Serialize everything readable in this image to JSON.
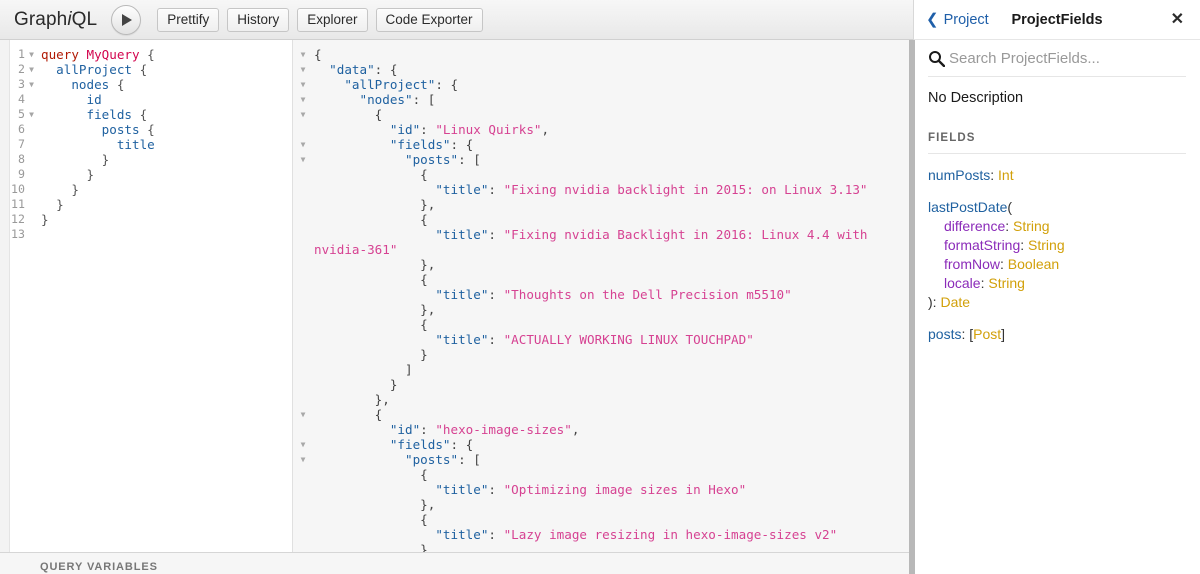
{
  "toolbar": {
    "logo_prefix": "Graph",
    "logo_italic": "i",
    "logo_suffix": "QL",
    "execute_label": "execute-query",
    "buttons": [
      {
        "label": "Prettify",
        "name": "prettify-button"
      },
      {
        "label": "History",
        "name": "history-button"
      },
      {
        "label": "Explorer",
        "name": "explorer-button"
      },
      {
        "label": "Code Exporter",
        "name": "code-exporter-button"
      }
    ]
  },
  "query_editor": {
    "variables_label": "QUERY VARIABLES",
    "lines": [
      {
        "num": "1",
        "fold": true,
        "indent": 0,
        "tokens": [
          {
            "t": "query",
            "c": "kw"
          },
          {
            "t": " ",
            "c": "pun"
          },
          {
            "t": "MyQuery",
            "c": "def"
          },
          {
            "t": " {",
            "c": "pun"
          }
        ]
      },
      {
        "num": "2",
        "fold": true,
        "indent": 1,
        "tokens": [
          {
            "t": "allProject",
            "c": "fld"
          },
          {
            "t": " {",
            "c": "pun"
          }
        ]
      },
      {
        "num": "3",
        "fold": true,
        "indent": 2,
        "tokens": [
          {
            "t": "nodes",
            "c": "fld"
          },
          {
            "t": " {",
            "c": "pun"
          }
        ]
      },
      {
        "num": "4",
        "fold": false,
        "indent": 3,
        "tokens": [
          {
            "t": "id",
            "c": "fld"
          }
        ]
      },
      {
        "num": "5",
        "fold": true,
        "indent": 3,
        "tokens": [
          {
            "t": "fields",
            "c": "fld"
          },
          {
            "t": " {",
            "c": "pun"
          }
        ]
      },
      {
        "num": "6",
        "fold": false,
        "indent": 4,
        "tokens": [
          {
            "t": "posts",
            "c": "fld"
          },
          {
            "t": " {",
            "c": "pun"
          }
        ]
      },
      {
        "num": "7",
        "fold": false,
        "indent": 5,
        "tokens": [
          {
            "t": "title",
            "c": "fld"
          }
        ]
      },
      {
        "num": "8",
        "fold": false,
        "indent": 4,
        "tokens": [
          {
            "t": "}",
            "c": "pun"
          }
        ]
      },
      {
        "num": "9",
        "fold": false,
        "indent": 3,
        "tokens": [
          {
            "t": "}",
            "c": "pun"
          }
        ]
      },
      {
        "num": "10",
        "fold": false,
        "indent": 2,
        "tokens": [
          {
            "t": "}",
            "c": "pun"
          }
        ]
      },
      {
        "num": "11",
        "fold": false,
        "indent": 1,
        "tokens": [
          {
            "t": "}",
            "c": "pun"
          }
        ]
      },
      {
        "num": "12",
        "fold": false,
        "indent": 0,
        "tokens": [
          {
            "t": "}",
            "c": "pun"
          }
        ]
      },
      {
        "num": "13",
        "fold": false,
        "indent": 0,
        "tokens": []
      }
    ]
  },
  "result_viewer": {
    "lines": [
      {
        "fold": true,
        "tokens": [
          {
            "t": "{",
            "c": "rp"
          }
        ]
      },
      {
        "fold": true,
        "tokens": [
          {
            "t": "  ",
            "c": "rp"
          },
          {
            "t": "\"data\"",
            "c": "rk"
          },
          {
            "t": ": {",
            "c": "rp"
          }
        ]
      },
      {
        "fold": true,
        "tokens": [
          {
            "t": "    ",
            "c": "rp"
          },
          {
            "t": "\"allProject\"",
            "c": "rk"
          },
          {
            "t": ": {",
            "c": "rp"
          }
        ]
      },
      {
        "fold": true,
        "tokens": [
          {
            "t": "      ",
            "c": "rp"
          },
          {
            "t": "\"nodes\"",
            "c": "rk"
          },
          {
            "t": ": [",
            "c": "rp"
          }
        ]
      },
      {
        "fold": true,
        "tokens": [
          {
            "t": "        {",
            "c": "rp"
          }
        ]
      },
      {
        "fold": false,
        "tokens": [
          {
            "t": "          ",
            "c": "rp"
          },
          {
            "t": "\"id\"",
            "c": "rk"
          },
          {
            "t": ": ",
            "c": "rp"
          },
          {
            "t": "\"Linux Quirks\"",
            "c": "rs"
          },
          {
            "t": ",",
            "c": "rp"
          }
        ]
      },
      {
        "fold": true,
        "tokens": [
          {
            "t": "          ",
            "c": "rp"
          },
          {
            "t": "\"fields\"",
            "c": "rk"
          },
          {
            "t": ": {",
            "c": "rp"
          }
        ]
      },
      {
        "fold": true,
        "tokens": [
          {
            "t": "            ",
            "c": "rp"
          },
          {
            "t": "\"posts\"",
            "c": "rk"
          },
          {
            "t": ": [",
            "c": "rp"
          }
        ]
      },
      {
        "fold": false,
        "tokens": [
          {
            "t": "              {",
            "c": "rp"
          }
        ]
      },
      {
        "fold": false,
        "tokens": [
          {
            "t": "                ",
            "c": "rp"
          },
          {
            "t": "\"title\"",
            "c": "rk"
          },
          {
            "t": ": ",
            "c": "rp"
          },
          {
            "t": "\"Fixing nvidia backlight in 2015: on Linux 3.13\"",
            "c": "rs"
          }
        ]
      },
      {
        "fold": false,
        "tokens": [
          {
            "t": "              },",
            "c": "rp"
          }
        ]
      },
      {
        "fold": false,
        "tokens": [
          {
            "t": "              {",
            "c": "rp"
          }
        ]
      },
      {
        "fold": false,
        "wrap": true,
        "tokens": [
          {
            "t": "                ",
            "c": "rp"
          },
          {
            "t": "\"title\"",
            "c": "rk"
          },
          {
            "t": ": ",
            "c": "rp"
          },
          {
            "t": "\"Fixing nvidia Backlight in 2016: Linux 4.4 with",
            "c": "rs"
          }
        ]
      },
      {
        "fold": false,
        "tokens": [
          {
            "t": "nvidia-361\"",
            "c": "rs"
          }
        ]
      },
      {
        "fold": false,
        "tokens": [
          {
            "t": "              },",
            "c": "rp"
          }
        ]
      },
      {
        "fold": false,
        "tokens": [
          {
            "t": "              {",
            "c": "rp"
          }
        ]
      },
      {
        "fold": false,
        "tokens": [
          {
            "t": "                ",
            "c": "rp"
          },
          {
            "t": "\"title\"",
            "c": "rk"
          },
          {
            "t": ": ",
            "c": "rp"
          },
          {
            "t": "\"Thoughts on the Dell Precision m5510\"",
            "c": "rs"
          }
        ]
      },
      {
        "fold": false,
        "tokens": [
          {
            "t": "              },",
            "c": "rp"
          }
        ]
      },
      {
        "fold": false,
        "tokens": [
          {
            "t": "              {",
            "c": "rp"
          }
        ]
      },
      {
        "fold": false,
        "tokens": [
          {
            "t": "                ",
            "c": "rp"
          },
          {
            "t": "\"title\"",
            "c": "rk"
          },
          {
            "t": ": ",
            "c": "rp"
          },
          {
            "t": "\"ACTUALLY WORKING LINUX TOUCHPAD\"",
            "c": "rs"
          }
        ]
      },
      {
        "fold": false,
        "tokens": [
          {
            "t": "              }",
            "c": "rp"
          }
        ]
      },
      {
        "fold": false,
        "tokens": [
          {
            "t": "            ]",
            "c": "rp"
          }
        ]
      },
      {
        "fold": false,
        "tokens": [
          {
            "t": "          }",
            "c": "rp"
          }
        ]
      },
      {
        "fold": false,
        "tokens": [
          {
            "t": "        },",
            "c": "rp"
          }
        ]
      },
      {
        "fold": true,
        "tokens": [
          {
            "t": "        {",
            "c": "rp"
          }
        ]
      },
      {
        "fold": false,
        "tokens": [
          {
            "t": "          ",
            "c": "rp"
          },
          {
            "t": "\"id\"",
            "c": "rk"
          },
          {
            "t": ": ",
            "c": "rp"
          },
          {
            "t": "\"hexo-image-sizes\"",
            "c": "rs"
          },
          {
            "t": ",",
            "c": "rp"
          }
        ]
      },
      {
        "fold": true,
        "tokens": [
          {
            "t": "          ",
            "c": "rp"
          },
          {
            "t": "\"fields\"",
            "c": "rk"
          },
          {
            "t": ": {",
            "c": "rp"
          }
        ]
      },
      {
        "fold": true,
        "tokens": [
          {
            "t": "            ",
            "c": "rp"
          },
          {
            "t": "\"posts\"",
            "c": "rk"
          },
          {
            "t": ": [",
            "c": "rp"
          }
        ]
      },
      {
        "fold": false,
        "tokens": [
          {
            "t": "              {",
            "c": "rp"
          }
        ]
      },
      {
        "fold": false,
        "tokens": [
          {
            "t": "                ",
            "c": "rp"
          },
          {
            "t": "\"title\"",
            "c": "rk"
          },
          {
            "t": ": ",
            "c": "rp"
          },
          {
            "t": "\"Optimizing image sizes in Hexo\"",
            "c": "rs"
          }
        ]
      },
      {
        "fold": false,
        "tokens": [
          {
            "t": "              },",
            "c": "rp"
          }
        ]
      },
      {
        "fold": false,
        "tokens": [
          {
            "t": "              {",
            "c": "rp"
          }
        ]
      },
      {
        "fold": false,
        "tokens": [
          {
            "t": "                ",
            "c": "rp"
          },
          {
            "t": "\"title\"",
            "c": "rk"
          },
          {
            "t": ": ",
            "c": "rp"
          },
          {
            "t": "\"Lazy image resizing in hexo-image-sizes v2\"",
            "c": "rs"
          }
        ]
      },
      {
        "fold": false,
        "tokens": [
          {
            "t": "              }",
            "c": "rp"
          }
        ]
      }
    ]
  },
  "docs": {
    "back_label": "Project",
    "back_icon": "chevron-left-icon",
    "title": "ProjectFields",
    "close_icon": "close-icon",
    "search_icon": "search-icon",
    "search_placeholder": "Search ProjectFields...",
    "search_value": "",
    "description": "No Description",
    "fields_heading": "FIELDS",
    "fields": [
      {
        "name": "numPosts",
        "sep": ": ",
        "type": "Int",
        "args": []
      },
      {
        "name": "lastPostDate",
        "open_paren": "(",
        "close_paren": ")",
        "sep": ": ",
        "type": "Date",
        "args": [
          {
            "name": "difference",
            "sep": ": ",
            "type": "String"
          },
          {
            "name": "formatString",
            "sep": ": ",
            "type": "String"
          },
          {
            "name": "fromNow",
            "sep": ": ",
            "type": "Boolean"
          },
          {
            "name": "locale",
            "sep": ": ",
            "type": "String"
          }
        ]
      },
      {
        "name": "posts",
        "sep": ": ",
        "type": "[Post]",
        "type_open": "[",
        "type_name": "Post",
        "type_close": "]",
        "args": []
      }
    ]
  },
  "colors": {
    "link": "#1f5fa9",
    "field": "#1f61a0",
    "type": "#d2a00a",
    "arg": "#8b2bb9",
    "string": "#d64292",
    "keyword": "#b11a04",
    "definition": "#d2054e"
  }
}
